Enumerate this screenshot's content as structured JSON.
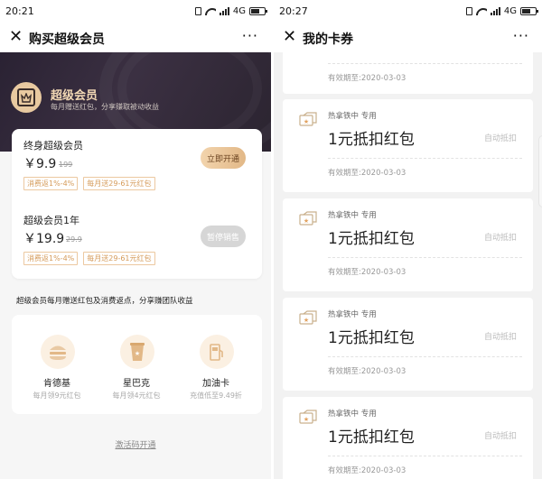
{
  "left": {
    "status": {
      "time": "20:21",
      "network": "4G"
    },
    "nav": {
      "close": "✕",
      "title": "购买超级会员",
      "more": "···"
    },
    "hero": {
      "title": "超级会员",
      "subtitle": "每月赠送红包，分享赚取被动收益"
    },
    "plans": [
      {
        "name": "终身超级会员",
        "price": "￥9.9",
        "original": "199",
        "tags": [
          "消费返1%-4%",
          "每月送29-61元红包"
        ],
        "button": "立即开通",
        "available": true
      },
      {
        "name": "超级会员1年",
        "price": "￥19.9",
        "original": "29.9",
        "tags": [
          "消费返1%-4%",
          "每月送29-61元红包"
        ],
        "button": "暂停销售",
        "available": false
      }
    ],
    "benefit_line": "超级会员每月赠送红包及消费返点，分享赚团队收益",
    "benefits": [
      {
        "name": "肯德基",
        "desc": "每月领9元红包",
        "icon": "burger-icon"
      },
      {
        "name": "星巴克",
        "desc": "每月领4元红包",
        "icon": "coffee-cup-icon"
      },
      {
        "name": "加油卡",
        "desc": "充值低至9.49折",
        "icon": "fuel-pump-icon"
      }
    ],
    "activate_link": "激活码开通"
  },
  "right": {
    "status": {
      "time": "20:27",
      "network": "4G"
    },
    "nav": {
      "close": "✕",
      "title": "我的卡券",
      "more": "···"
    },
    "top_partial": {
      "expiry": "有效期至:2020-03-03"
    },
    "coupons": [
      {
        "store": "热拿铁中 专用",
        "amount": "1元抵扣红包",
        "auto": "自动抵扣",
        "expiry": "有效期至:2020-03-03"
      },
      {
        "store": "热拿铁中 专用",
        "amount": "1元抵扣红包",
        "auto": "自动抵扣",
        "expiry": "有效期至:2020-03-03"
      },
      {
        "store": "热拿铁中 专用",
        "amount": "1元抵扣红包",
        "auto": "自动抵扣",
        "expiry": "有效期至:2020-03-03"
      },
      {
        "store": "热拿铁中 专用",
        "amount": "1元抵扣红包",
        "auto": "自动抵扣",
        "expiry": "有效期至:2020-03-03"
      }
    ]
  },
  "colors": {
    "gold": "#e2b887",
    "tag_border": "#ecc8a0",
    "tag_text": "#d59b5a",
    "hero_dark": "#2a2233"
  }
}
